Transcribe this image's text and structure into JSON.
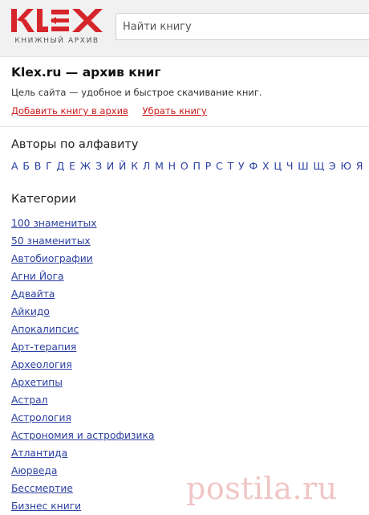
{
  "header": {
    "logo_text": "KLEX",
    "logo_tagline": "КНИЖНЫЙ АРХИВ",
    "search_placeholder": "Найти книгу"
  },
  "intro": {
    "title": "Klex.ru — архив книг",
    "description": "Цель сайта — удобное и быстрое скачивание книг.",
    "add_book_link": "Добавить книгу в архив",
    "remove_book_link": "Убрать книгу"
  },
  "authors": {
    "heading": "Авторы по алфавиту",
    "letters": [
      "А",
      "Б",
      "В",
      "Г",
      "Д",
      "Е",
      "Ж",
      "З",
      "И",
      "Й",
      "К",
      "Л",
      "М",
      "Н",
      "О",
      "П",
      "Р",
      "С",
      "Т",
      "У",
      "Ф",
      "Х",
      "Ц",
      "Ч",
      "Ш",
      "Щ",
      "Э",
      "Ю",
      "Я"
    ]
  },
  "categories": {
    "heading": "Категории",
    "items": [
      "100 знаменитых",
      "50 знаменитых",
      "Автобиографии",
      "Агни Йога",
      "Адвайта",
      "Айкидо",
      "Апокалипсис",
      "Арт-терапия",
      "Археология",
      "Архетипы",
      "Астрал",
      "Астрология",
      "Астрономия и астрофизика",
      "Атлантида",
      "Аюрведа",
      "Бессмертие",
      "Бизнес книги"
    ]
  },
  "watermark": "postila.ru",
  "colors": {
    "logo_red": "#d6262b",
    "link_blue": "#2b3fa0",
    "action_red": "#cc1b1b",
    "header_bg": "#f1f1f1"
  }
}
